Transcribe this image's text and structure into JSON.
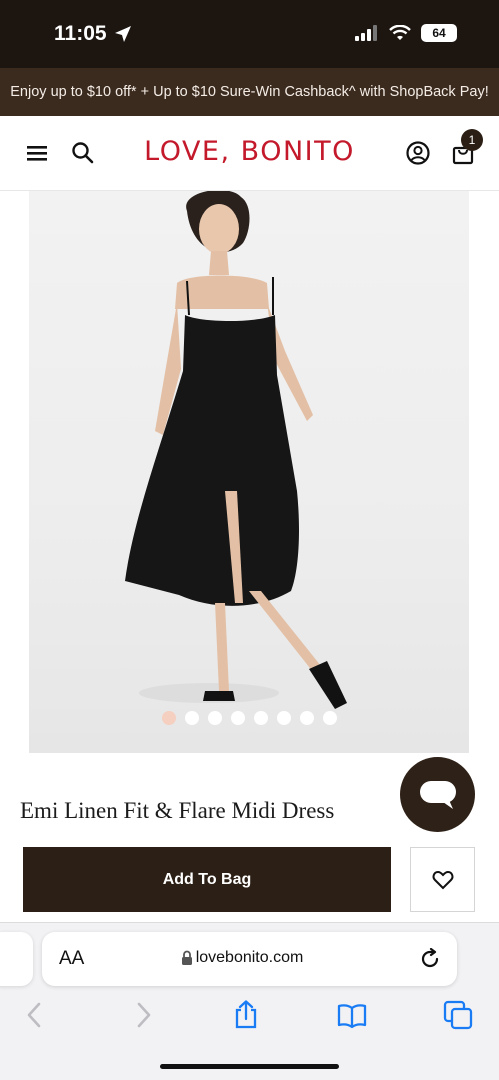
{
  "status_bar": {
    "time": "11:05",
    "battery": "64"
  },
  "promo": {
    "text": "Enjoy up to $10 off* + Up to $10 Sure-Win Cashback^ with ShopBack Pay!"
  },
  "header": {
    "logo": "LOVE, BONITO",
    "cart_count": "1"
  },
  "carousel": {
    "total_slides": 8,
    "active_index": 0
  },
  "product": {
    "title": "Emi Linen Fit & Flare Midi Dress"
  },
  "actions": {
    "add_to_bag": "Add To Bag"
  },
  "browser": {
    "text_size_label": "AA",
    "url": "lovebonito.com"
  },
  "colors": {
    "brand_red": "#c3192b",
    "dark_brown": "#2c1f15",
    "promo_bg": "#3b2a1e",
    "active_dot": "#f5cfc0",
    "safari_blue": "#1a7cf5"
  },
  "icons": [
    "location-arrow-icon",
    "signal-icon",
    "wifi-icon",
    "menu-icon",
    "search-icon",
    "account-icon",
    "bag-icon",
    "chat-icon",
    "heart-icon",
    "lock-icon",
    "reload-icon",
    "back-icon",
    "forward-icon",
    "share-icon",
    "bookmarks-icon",
    "tabs-icon"
  ]
}
